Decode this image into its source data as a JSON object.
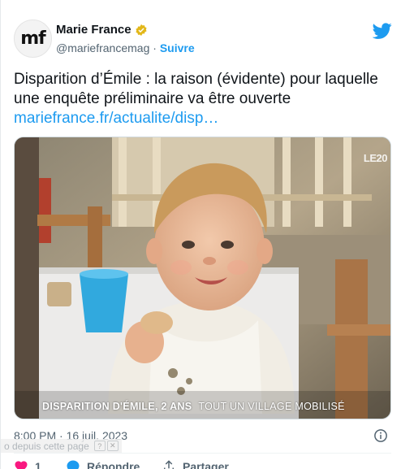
{
  "tweet": {
    "avatar_text": "mf",
    "display_name": "Marie France",
    "handle": "@mariefrancemag",
    "separator": " · ",
    "follow_label": "Suivre",
    "text": "Disparition d’Émile : la raison (évidente) pour laquelle une enquête préliminaire va être ouverte",
    "link": "mariefrance.fr/actualite/disp…",
    "timestamp": "8:00 PM · 16 juil. 2023"
  },
  "media": {
    "caption_main": "DISPARITION D'ÉMILE, 2 ANS",
    "caption_sub": "TOUT UN VILLAGE MOBILISÉ",
    "channel": "LE20"
  },
  "overlay": {
    "ghost_text": "o depuis cette page",
    "ghost_icons": [
      "?",
      "✕"
    ]
  },
  "actions": {
    "like_count": "1",
    "reply_label": "Répondre",
    "share_label": "Partager"
  },
  "colors": {
    "accent": "#1d9bf0",
    "like": "#f91880",
    "verified": "#e2b719"
  },
  "icons": [
    "twitter-bird-icon",
    "verified-badge-icon",
    "info-icon",
    "heart-icon",
    "reply-icon",
    "share-icon"
  ]
}
